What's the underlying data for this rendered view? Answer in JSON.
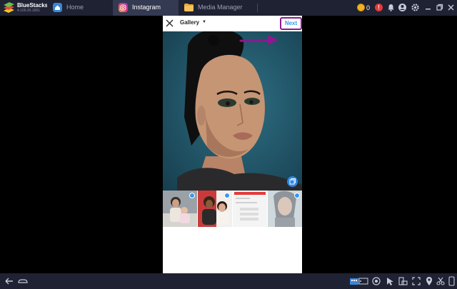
{
  "app": {
    "name": "BlueStacks",
    "version": "4.100.20.1001",
    "accent": "#3897f0",
    "window_bar_color": "#1f2233"
  },
  "tabs": [
    {
      "label": "Home",
      "icon": "home-icon",
      "active": false
    },
    {
      "label": "Instagram",
      "icon": "instagram-icon",
      "active": true
    },
    {
      "label": "Media Manager",
      "icon": "folder-icon",
      "active": false
    }
  ],
  "status": {
    "coins": "0",
    "alert_glyph": "!"
  },
  "instagram": {
    "gallery_label": "Gallery",
    "next_label": "Next",
    "next_highlight_color": "#8b1a8f",
    "thumbnails": [
      {
        "name": "thumb-family-photo",
        "selected": true
      },
      {
        "name": "thumb-couple-photo",
        "selected": true
      },
      {
        "name": "thumb-app-screenshot",
        "selected": false
      },
      {
        "name": "thumb-portrait-faded",
        "selected": true
      }
    ]
  },
  "bottom_icons": [
    "back-icon",
    "home-icon",
    "keyboard-icon",
    "gamepad-icon",
    "eye-icon",
    "cursor-icon",
    "rotate-icon",
    "fullscreen-icon",
    "location-icon",
    "scissors-icon",
    "phone-icon"
  ]
}
